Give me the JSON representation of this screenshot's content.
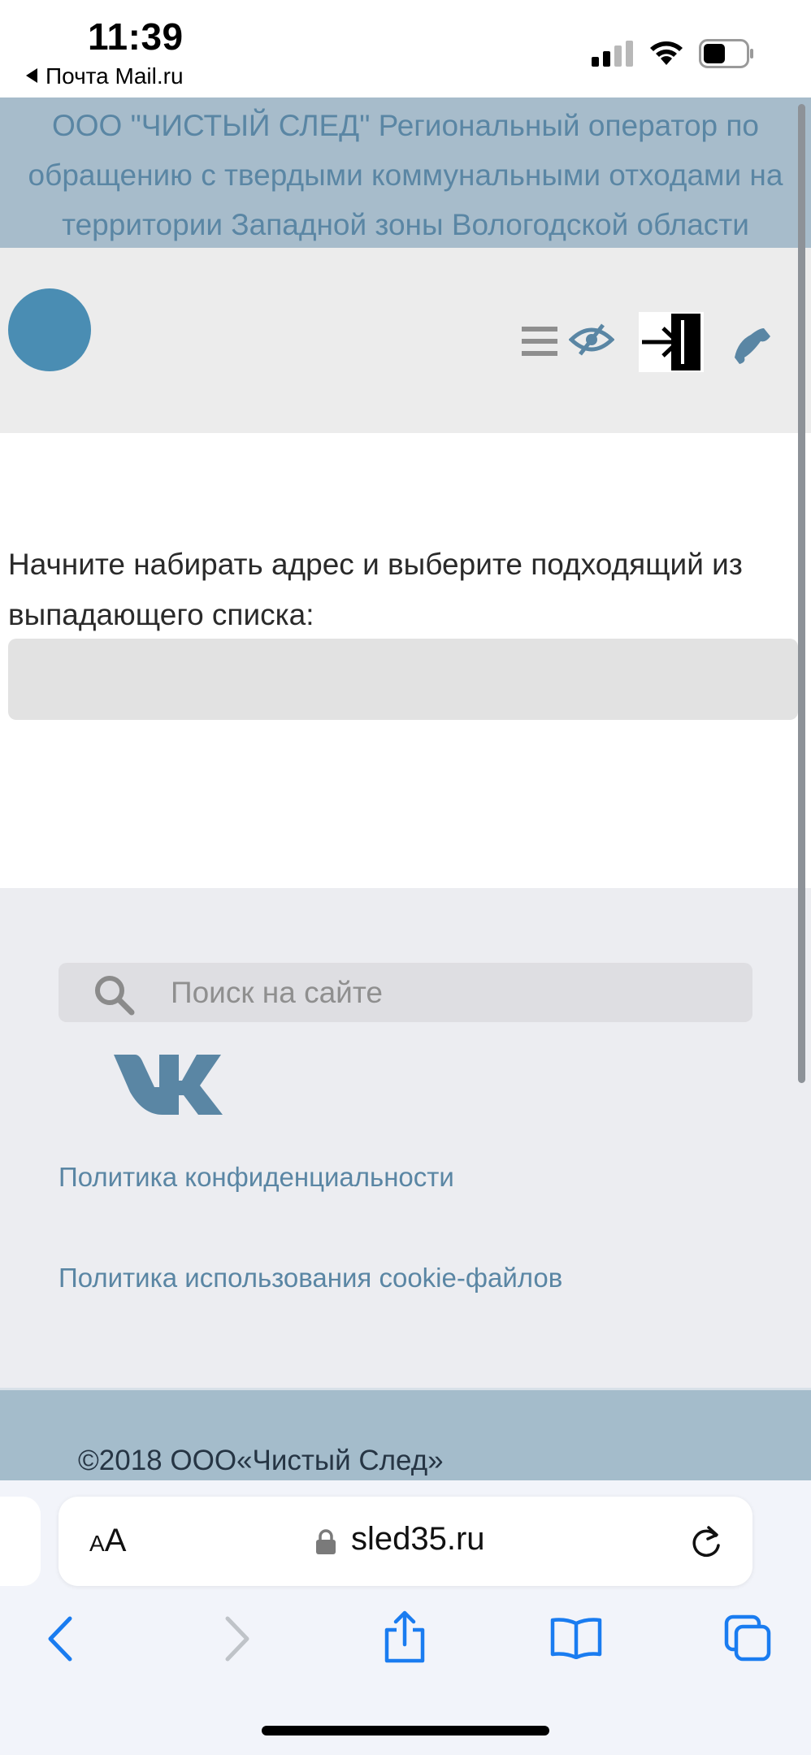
{
  "status_bar": {
    "time": "11:39",
    "back_app": "Почта Mail.ru",
    "signal_icon": "cellular-signal-icon",
    "wifi_icon": "wifi-icon",
    "battery_icon": "battery-icon"
  },
  "banner": {
    "text": "ООО \"ЧИСТЫЙ СЛЕД\" Региональный оператор по обращению с твердыми коммунальными отходами на территории Западной зоны Вологодской области"
  },
  "nav": {
    "logo_color": "#4a8db3",
    "icons": [
      "menu-icon",
      "eye-slash-icon",
      "login-icon",
      "phone-icon"
    ]
  },
  "main": {
    "prompt": "Начните набирать адрес и выберите подходящий из выпадающего списка:",
    "address_value": ""
  },
  "footer": {
    "search_placeholder": "Поиск на сайте",
    "social_icon": "vk-icon",
    "privacy_link": "Политика конфиденциальности",
    "cookie_link": "Политика использования cookie-файлов",
    "copyright": "©2018 ООО«Чистый След»"
  },
  "browser": {
    "aa_label_small": "A",
    "aa_label_large": "A",
    "url": "sled35.ru",
    "toolbar": [
      "back-icon",
      "forward-icon",
      "share-icon",
      "bookmarks-icon",
      "tabs-icon"
    ]
  },
  "colors": {
    "banner_bg": "#a7bccb",
    "banner_text": "#5a86a4",
    "link": "#5a86a4",
    "safari_blue": "#1a7cf0"
  }
}
